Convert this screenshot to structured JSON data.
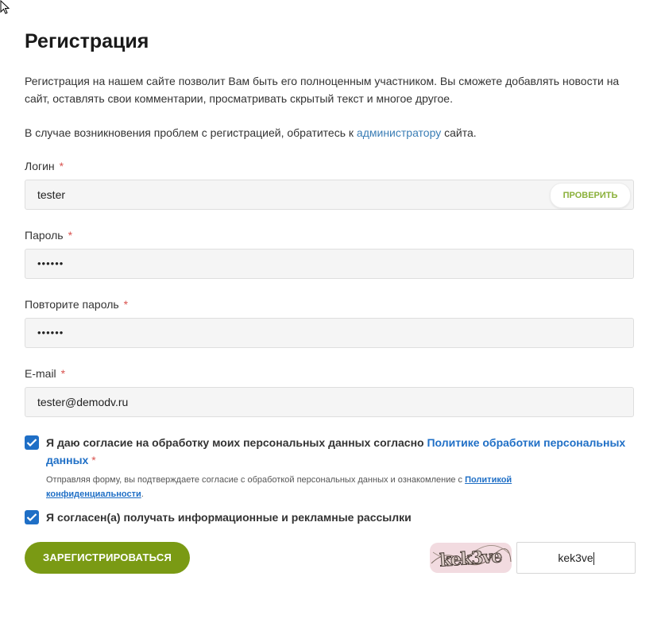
{
  "title": "Регистрация",
  "intro": "Регистрация на нашем сайте позволит Вам быть его полноценным участником. Вы сможете добавлять новости на сайт, оставлять свои комментарии, просматривать скрытый текст и многое другое.",
  "problem": {
    "before": "В случае возникновения проблем с регистрацией, обратитесь к ",
    "link": "администратору",
    "after": " сайта."
  },
  "required_mark": "*",
  "fields": {
    "login": {
      "label": "Логин",
      "value": "tester",
      "check_label": "ПРОВЕРИТЬ"
    },
    "password": {
      "label": "Пароль",
      "value": "••••••"
    },
    "password_repeat": {
      "label": "Повторите пароль",
      "value": "••••••"
    },
    "email": {
      "label": "E-mail",
      "value": "tester@demodv.ru"
    }
  },
  "consent": {
    "checked": true,
    "text": "Я даю согласие на обработку моих персональных данных согласно ",
    "link": "Политике обработки персональных данных",
    "note_before": "Отправляя форму, вы подтверждаете согласие с обработкой персональных данных и ознакомление с ",
    "note_link": "Политикой конфиденциальности",
    "note_after": "."
  },
  "newsletter": {
    "checked": true,
    "text": "Я согласен(а) получать информационные и рекламные рассылки"
  },
  "submit_label": "ЗАРЕГИСТРИРОВАТЬСЯ",
  "captcha": {
    "image_text": "kek3ve",
    "input_value": "kek3ve"
  },
  "colors": {
    "accent_green": "#7a9a14",
    "link_blue": "#1f6fc6",
    "required_red": "#d9534f",
    "checkbox_blue": "#1f6fc6"
  }
}
